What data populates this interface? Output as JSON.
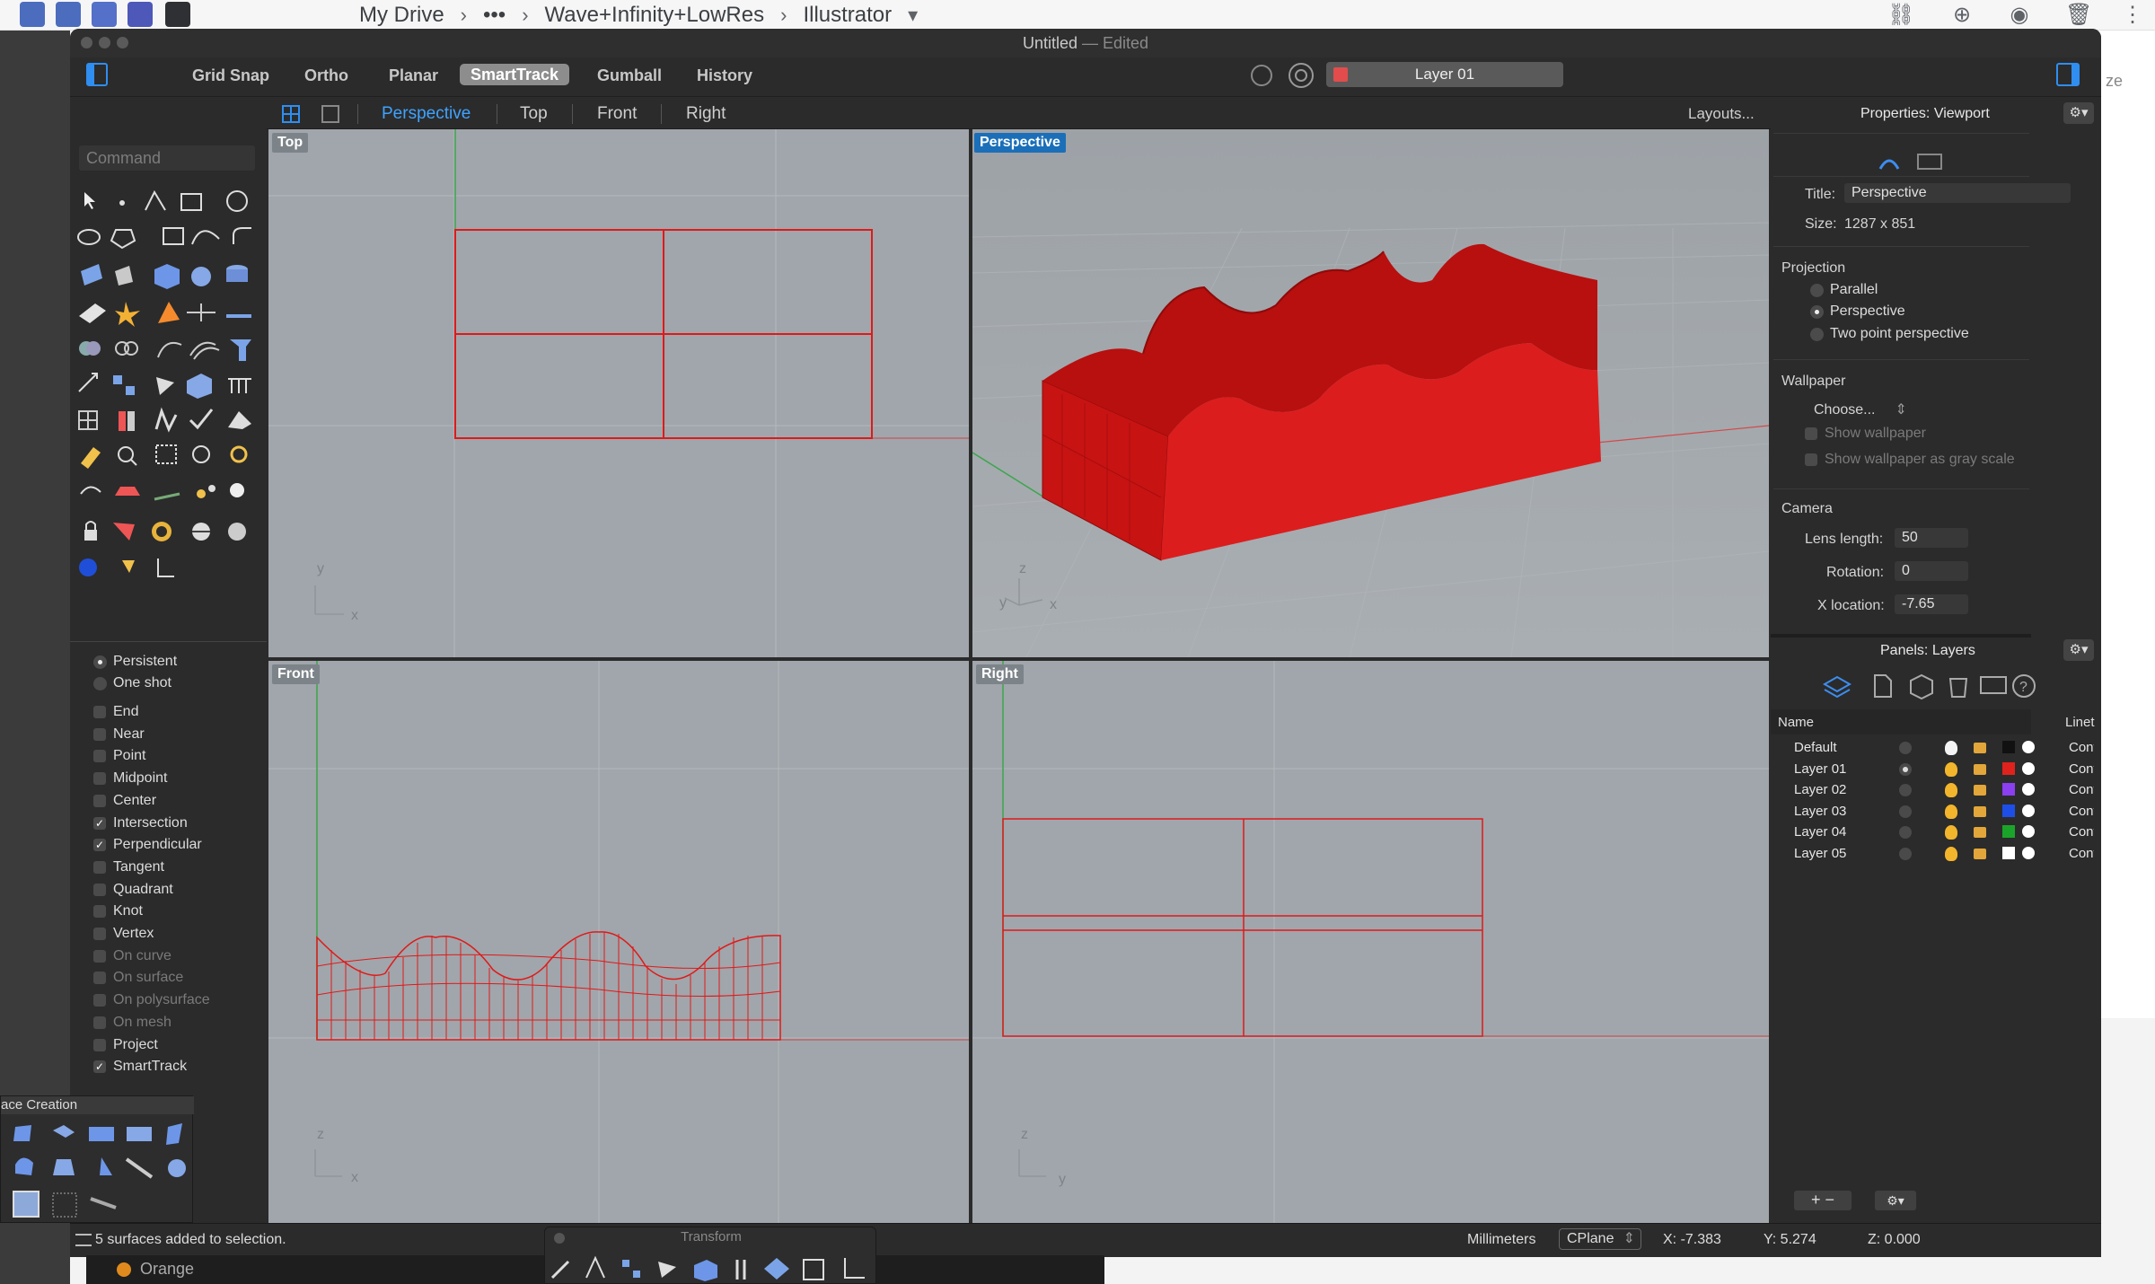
{
  "browser": {
    "breadcrumb": [
      "My Drive",
      "Wave+Infinity+LowRes",
      "Illustrator"
    ],
    "more_label": "•••",
    "sep": "›",
    "dropdown_caret": "▾",
    "right_edge_fragment": "ze"
  },
  "window": {
    "title": "Untitled",
    "title_sep": " — ",
    "title_status": "Edited"
  },
  "toolbar": {
    "buttons": [
      "Grid Snap",
      "Ortho",
      "Planar",
      "SmartTrack",
      "Gumball",
      "History"
    ],
    "active": "SmartTrack",
    "current_layer": "Layer 01",
    "current_layer_color": "#e24c4c"
  },
  "viewport_tabs": {
    "tabs": [
      "Perspective",
      "Top",
      "Front",
      "Right"
    ],
    "active": "Perspective",
    "layouts_label": "Layouts..."
  },
  "command": {
    "placeholder": "Command"
  },
  "snaps": {
    "persistent": "Persistent",
    "one_shot": "One shot",
    "items": [
      {
        "label": "End",
        "checked": false,
        "enabled": true
      },
      {
        "label": "Near",
        "checked": false,
        "enabled": true
      },
      {
        "label": "Point",
        "checked": false,
        "enabled": true
      },
      {
        "label": "Midpoint",
        "checked": false,
        "enabled": true
      },
      {
        "label": "Center",
        "checked": false,
        "enabled": true
      },
      {
        "label": "Intersection",
        "checked": true,
        "enabled": true
      },
      {
        "label": "Perpendicular",
        "checked": true,
        "enabled": true
      },
      {
        "label": "Tangent",
        "checked": false,
        "enabled": true
      },
      {
        "label": "Quadrant",
        "checked": false,
        "enabled": true
      },
      {
        "label": "Knot",
        "checked": false,
        "enabled": true
      },
      {
        "label": "Vertex",
        "checked": false,
        "enabled": true
      },
      {
        "label": "On curve",
        "checked": false,
        "enabled": false
      },
      {
        "label": "On surface",
        "checked": false,
        "enabled": false
      },
      {
        "label": "On polysurface",
        "checked": false,
        "enabled": false
      },
      {
        "label": "On mesh",
        "checked": false,
        "enabled": false
      },
      {
        "label": "Project",
        "checked": false,
        "enabled": true
      },
      {
        "label": "SmartTrack",
        "checked": true,
        "enabled": true
      }
    ]
  },
  "viewports": {
    "top": "Top",
    "perspective": "Perspective",
    "front": "Front",
    "right": "Right",
    "axis_x": "x",
    "axis_y": "y",
    "axis_z": "z"
  },
  "properties": {
    "header": "Properties: Viewport",
    "title_label": "Title:",
    "title_value": "Perspective",
    "size_label": "Size:",
    "size_value": "1287 x 851",
    "projection_label": "Projection",
    "projection_options": [
      "Parallel",
      "Perspective",
      "Two point perspective"
    ],
    "projection_selected": "Perspective",
    "wallpaper_label": "Wallpaper",
    "choose_label": "Choose...",
    "show_wallpaper": "Show wallpaper",
    "show_gray": "Show wallpaper as gray scale",
    "camera_label": "Camera",
    "lens_label": "Lens length:",
    "lens_value": "50",
    "rotation_label": "Rotation:",
    "rotation_value": "0",
    "xloc_label": "X location:",
    "xloc_value": "-7.65"
  },
  "layers_panel": {
    "header": "Panels: Layers",
    "col_name": "Name",
    "col_linetype": "Linet",
    "rows": [
      {
        "name": "Default",
        "color": "#111111",
        "current": false,
        "linetype": "Cont"
      },
      {
        "name": "Layer 01",
        "color": "#e0221c",
        "current": true,
        "linetype": "Cont"
      },
      {
        "name": "Layer 02",
        "color": "#8a3ff0",
        "current": false,
        "linetype": "Cont"
      },
      {
        "name": "Layer 03",
        "color": "#1d4fe8",
        "current": false,
        "linetype": "Cont"
      },
      {
        "name": "Layer 04",
        "color": "#1aa52a",
        "current": false,
        "linetype": "Cont"
      },
      {
        "name": "Layer 05",
        "color": "#ffffff",
        "current": false,
        "linetype": "Cont"
      }
    ]
  },
  "palettes": {
    "surface_title": "ace Creation",
    "transform_title": "Transform"
  },
  "status": {
    "message": "5 surfaces added to selection.",
    "units": "Millimeters",
    "cplane": "CPlane",
    "x": "X: -7.383",
    "y": "Y: 5.274",
    "z": "Z: 0.000",
    "bottom_item": "Orange"
  }
}
